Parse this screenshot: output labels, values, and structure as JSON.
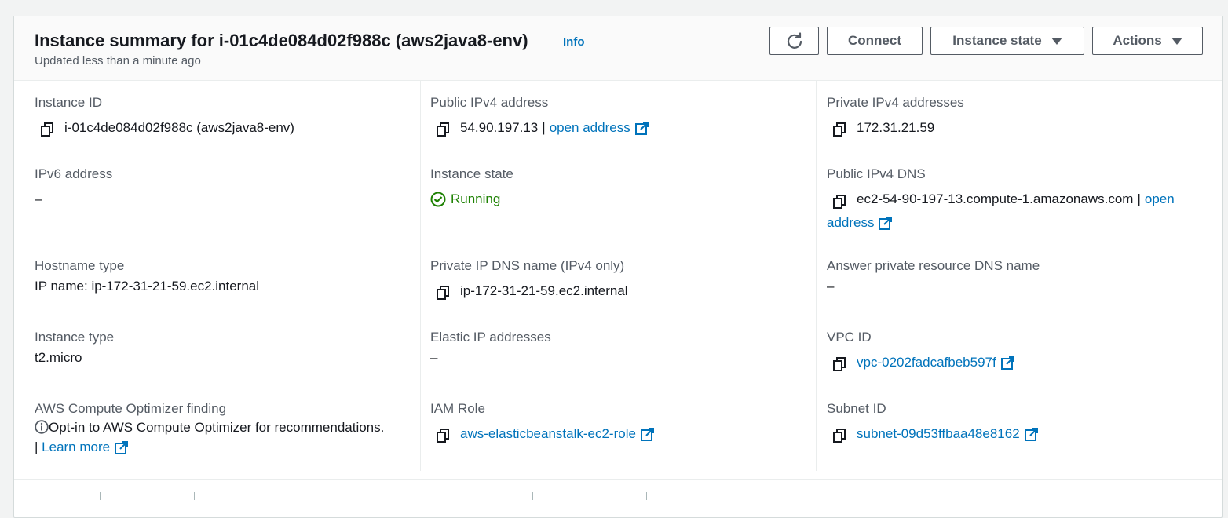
{
  "header": {
    "title": "Instance summary for i-01c4de084d02f988c (aws2java8-env)",
    "info_label": "Info",
    "subtitle": "Updated less than a minute ago",
    "connect_label": "Connect",
    "instance_state_label": "Instance state",
    "actions_label": "Actions"
  },
  "fields": {
    "instance_id": {
      "label": "Instance ID",
      "value": "i-01c4de084d02f988c (aws2java8-env)"
    },
    "public_ipv4": {
      "label": "Public IPv4 address",
      "value": "54.90.197.13",
      "sep": "|",
      "link": "open address"
    },
    "private_ipv4": {
      "label": "Private IPv4 addresses",
      "value": "172.31.21.59"
    },
    "ipv6": {
      "label": "IPv6 address",
      "value": "–"
    },
    "instance_state": {
      "label": "Instance state",
      "value": "Running"
    },
    "public_dns": {
      "label": "Public IPv4 DNS",
      "value": "ec2-54-90-197-13.compute-1.amazonaws.com",
      "sep": "|",
      "link1": "open",
      "link2": "address"
    },
    "hostname_type": {
      "label": "Hostname type",
      "value": "IP name: ip-172-31-21-59.ec2.internal"
    },
    "private_dns": {
      "label": "Private IP DNS name (IPv4 only)",
      "value": "ip-172-31-21-59.ec2.internal"
    },
    "answer_dns": {
      "label": "Answer private resource DNS name",
      "value": "–"
    },
    "instance_type": {
      "label": "Instance type",
      "value": "t2.micro"
    },
    "elastic_ip": {
      "label": "Elastic IP addresses",
      "value": "–"
    },
    "vpc_id": {
      "label": "VPC ID",
      "value": "vpc-0202fadcafbeb597f"
    },
    "optimizer": {
      "label": "AWS Compute Optimizer finding",
      "value": "Opt-in to AWS Compute Optimizer for recommendations.",
      "sep": "|",
      "link": "Learn more"
    },
    "iam_role": {
      "label": "IAM Role",
      "value": "aws-elasticbeanstalk-ec2-role"
    },
    "subnet_id": {
      "label": "Subnet ID",
      "value": "subnet-09d53ffbaa48e8162"
    }
  },
  "colors": {
    "link": "#0073bb",
    "running": "#1d8102",
    "label": "#545b64",
    "text": "#16191f"
  }
}
